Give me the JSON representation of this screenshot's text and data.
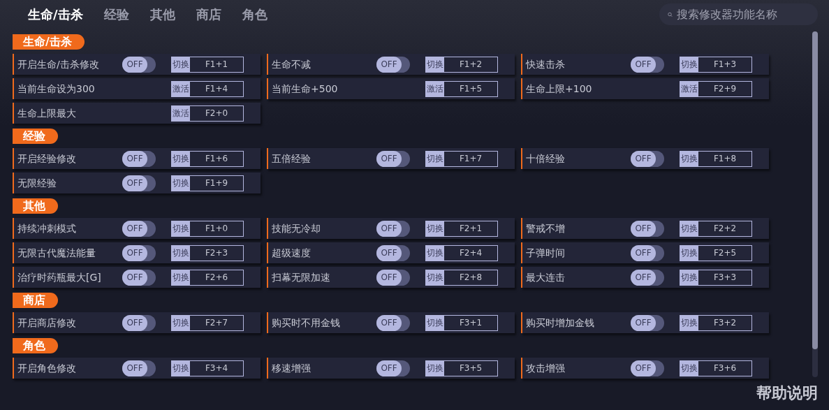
{
  "tabs": [
    {
      "label": "生命/击杀",
      "selected": true
    },
    {
      "label": "经验",
      "selected": false
    },
    {
      "label": "其他",
      "selected": false
    },
    {
      "label": "商店",
      "selected": false
    },
    {
      "label": "角色",
      "selected": false
    }
  ],
  "search": {
    "placeholder": "搜索修改器功能名称"
  },
  "sections": [
    {
      "title": "生命/击杀",
      "rows": [
        {
          "label": "开启生命/击杀修改",
          "kind": "toggle",
          "toggle_text": "OFF",
          "on": false,
          "action": "切换",
          "hotkey": "F1+1"
        },
        {
          "label": "生命不减",
          "kind": "toggle",
          "toggle_text": "OFF",
          "on": false,
          "action": "切换",
          "hotkey": "F1+2"
        },
        {
          "label": "快速击杀",
          "kind": "toggle",
          "toggle_text": "OFF",
          "on": false,
          "action": "切换",
          "hotkey": "F1+3"
        },
        {
          "label": "当前生命设为300",
          "kind": "button",
          "action": "激活",
          "hotkey": "F1+4"
        },
        {
          "label": "当前生命+500",
          "kind": "button",
          "action": "激活",
          "hotkey": "F1+5"
        },
        {
          "label": "生命上限+100",
          "kind": "button",
          "action": "激活",
          "hotkey": "F2+9"
        },
        {
          "label": "生命上限最大",
          "kind": "button",
          "action": "激活",
          "hotkey": "F2+0"
        }
      ]
    },
    {
      "title": "经验",
      "rows": [
        {
          "label": "开启经验修改",
          "kind": "toggle",
          "toggle_text": "OFF",
          "on": false,
          "action": "切换",
          "hotkey": "F1+6"
        },
        {
          "label": "五倍经验",
          "kind": "toggle",
          "toggle_text": "OFF",
          "on": false,
          "action": "切换",
          "hotkey": "F1+7"
        },
        {
          "label": "十倍经验",
          "kind": "toggle",
          "toggle_text": "OFF",
          "on": false,
          "action": "切换",
          "hotkey": "F1+8"
        },
        {
          "label": "无限经验",
          "kind": "toggle",
          "toggle_text": "OFF",
          "on": false,
          "action": "切换",
          "hotkey": "F1+9"
        }
      ]
    },
    {
      "title": "其他",
      "rows": [
        {
          "label": "持续冲刺模式",
          "kind": "toggle",
          "toggle_text": "OFF",
          "on": false,
          "action": "切换",
          "hotkey": "F1+0"
        },
        {
          "label": "技能无冷却",
          "kind": "toggle",
          "toggle_text": "OFF",
          "on": false,
          "action": "切换",
          "hotkey": "F2+1"
        },
        {
          "label": "警戒不增",
          "kind": "toggle",
          "toggle_text": "OFF",
          "on": false,
          "action": "切换",
          "hotkey": "F2+2"
        },
        {
          "label": "无限古代魔法能量",
          "kind": "toggle",
          "toggle_text": "OFF",
          "on": false,
          "action": "切换",
          "hotkey": "F2+3"
        },
        {
          "label": "超级速度",
          "kind": "toggle",
          "toggle_text": "OFF",
          "on": false,
          "action": "切换",
          "hotkey": "F2+4"
        },
        {
          "label": "子弹时间",
          "kind": "toggle",
          "toggle_text": "OFF",
          "on": false,
          "action": "切换",
          "hotkey": "F2+5"
        },
        {
          "label": "治疗时药瓶最大[G]",
          "kind": "toggle",
          "toggle_text": "OFF",
          "on": false,
          "action": "切换",
          "hotkey": "F2+6"
        },
        {
          "label": "扫幕无限加速",
          "kind": "toggle",
          "toggle_text": "OFF",
          "on": false,
          "action": "切换",
          "hotkey": "F2+8"
        },
        {
          "label": "最大连击",
          "kind": "toggle",
          "toggle_text": "OFF",
          "on": false,
          "action": "切换",
          "hotkey": "F3+3"
        }
      ]
    },
    {
      "title": "商店",
      "rows": [
        {
          "label": "开启商店修改",
          "kind": "toggle",
          "toggle_text": "OFF",
          "on": false,
          "action": "切换",
          "hotkey": "F2+7"
        },
        {
          "label": "购买时不用金钱",
          "kind": "toggle",
          "toggle_text": "OFF",
          "on": false,
          "action": "切换",
          "hotkey": "F3+1"
        },
        {
          "label": "购买时增加金钱",
          "kind": "toggle",
          "toggle_text": "OFF",
          "on": false,
          "action": "切换",
          "hotkey": "F3+2"
        }
      ]
    },
    {
      "title": "角色",
      "rows": [
        {
          "label": "开启角色修改",
          "kind": "toggle",
          "toggle_text": "OFF",
          "on": false,
          "action": "切换",
          "hotkey": "F3+4"
        },
        {
          "label": "移速增强",
          "kind": "toggle",
          "toggle_text": "OFF",
          "on": false,
          "action": "切换",
          "hotkey": "F3+5"
        },
        {
          "label": "攻击增强",
          "kind": "toggle",
          "toggle_text": "OFF",
          "on": false,
          "action": "切换",
          "hotkey": "F3+6"
        }
      ]
    }
  ],
  "help_label": "帮助说明"
}
